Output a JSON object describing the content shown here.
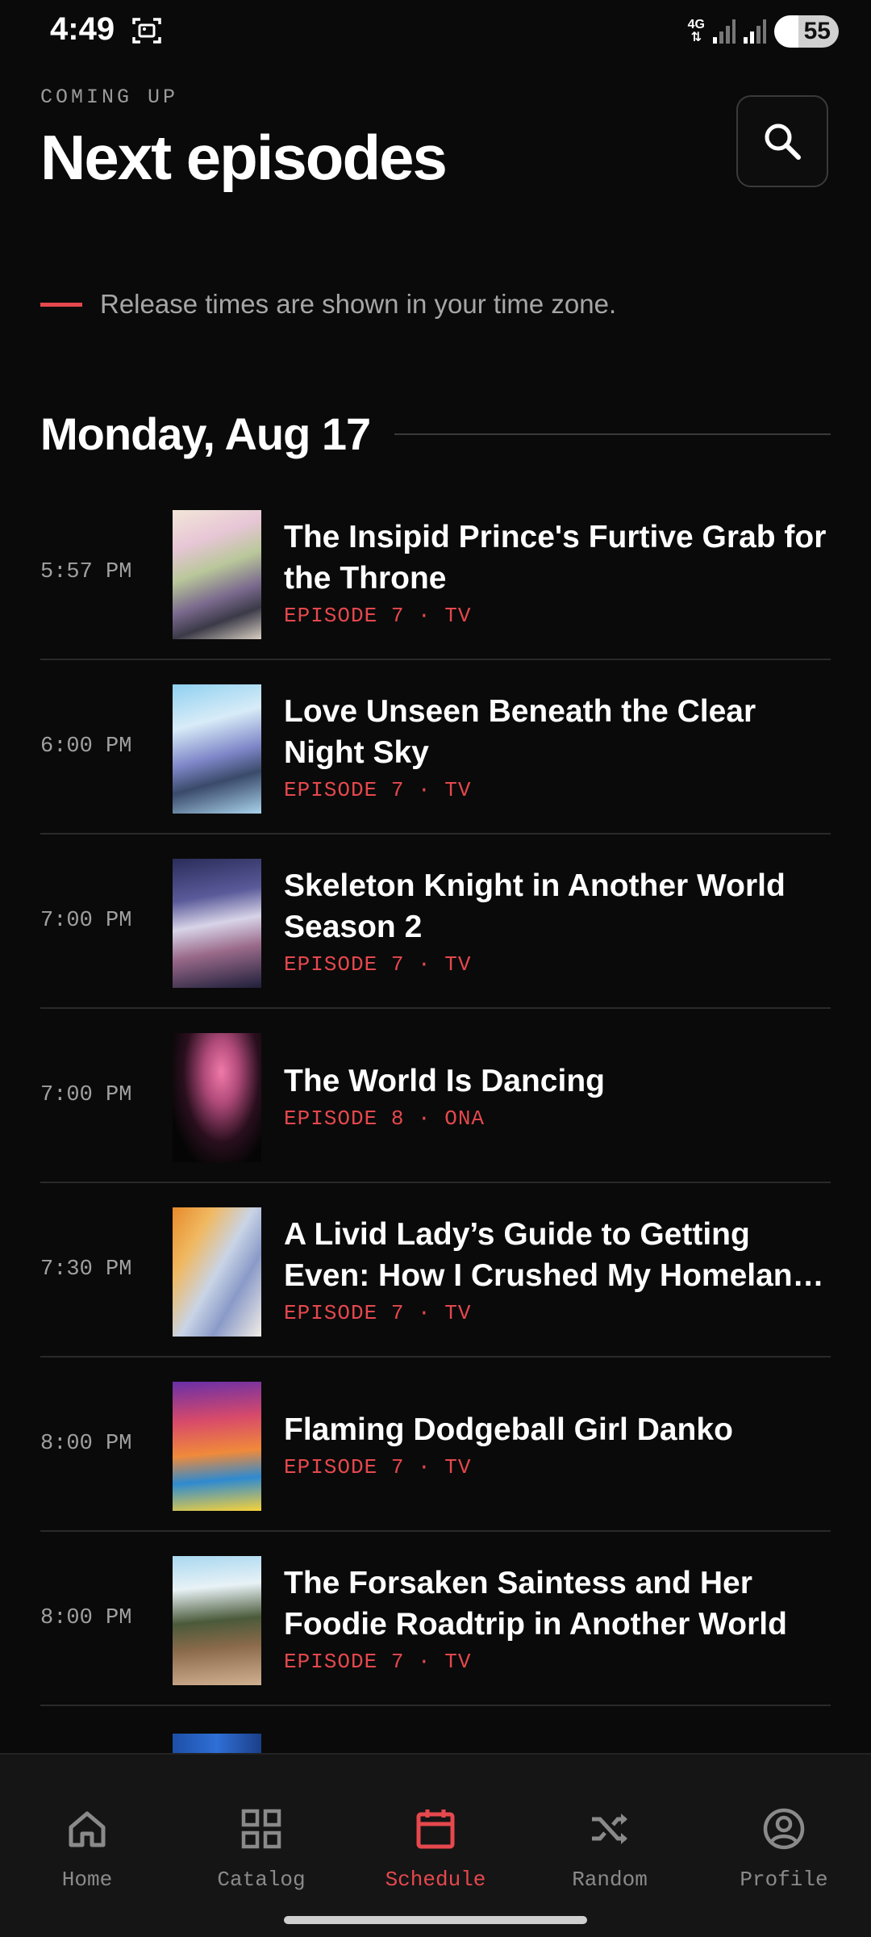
{
  "status_bar": {
    "time": "4:49",
    "network": "4G",
    "battery": "55"
  },
  "header": {
    "eyebrow": "COMING UP",
    "title": "Next episodes"
  },
  "notice": "Release times are shown in your time zone.",
  "day": {
    "label": "Monday, Aug 17"
  },
  "episodes": [
    {
      "time": "5:57 PM",
      "title": "The Insipid Prince's Furtive Grab for the Throne",
      "meta": "EPISODE 7 · TV"
    },
    {
      "time": "6:00 PM",
      "title": "Love Unseen Beneath the Clear Night Sky",
      "meta": "EPISODE 7 · TV"
    },
    {
      "time": "7:00 PM",
      "title": "Skeleton Knight in Another World Season 2",
      "meta": "EPISODE 7 · TV"
    },
    {
      "time": "7:00 PM",
      "title": "The World Is Dancing",
      "meta": "EPISODE 8 · ONA"
    },
    {
      "time": "7:30 PM",
      "title": "A Livid Lady’s Guide to Getting Even: How I Crushed My Homeland with …",
      "meta": "EPISODE 7 · TV"
    },
    {
      "time": "8:00 PM",
      "title": "Flaming Dodgeball Girl Danko",
      "meta": "EPISODE 7 · TV"
    },
    {
      "time": "8:00 PM",
      "title": "The Forsaken Saintess and Her Foodie Roadtrip in Another World",
      "meta": "EPISODE 7 · TV"
    }
  ],
  "nav": {
    "items": [
      {
        "label": "Home",
        "icon": "home-icon"
      },
      {
        "label": "Catalog",
        "icon": "grid-icon"
      },
      {
        "label": "Schedule",
        "icon": "calendar-icon",
        "active": true
      },
      {
        "label": "Random",
        "icon": "shuffle-icon"
      },
      {
        "label": "Profile",
        "icon": "profile-icon"
      }
    ]
  },
  "colors": {
    "accent": "#e5484d",
    "background": "#0a0a0a",
    "nav_background": "#151515"
  }
}
